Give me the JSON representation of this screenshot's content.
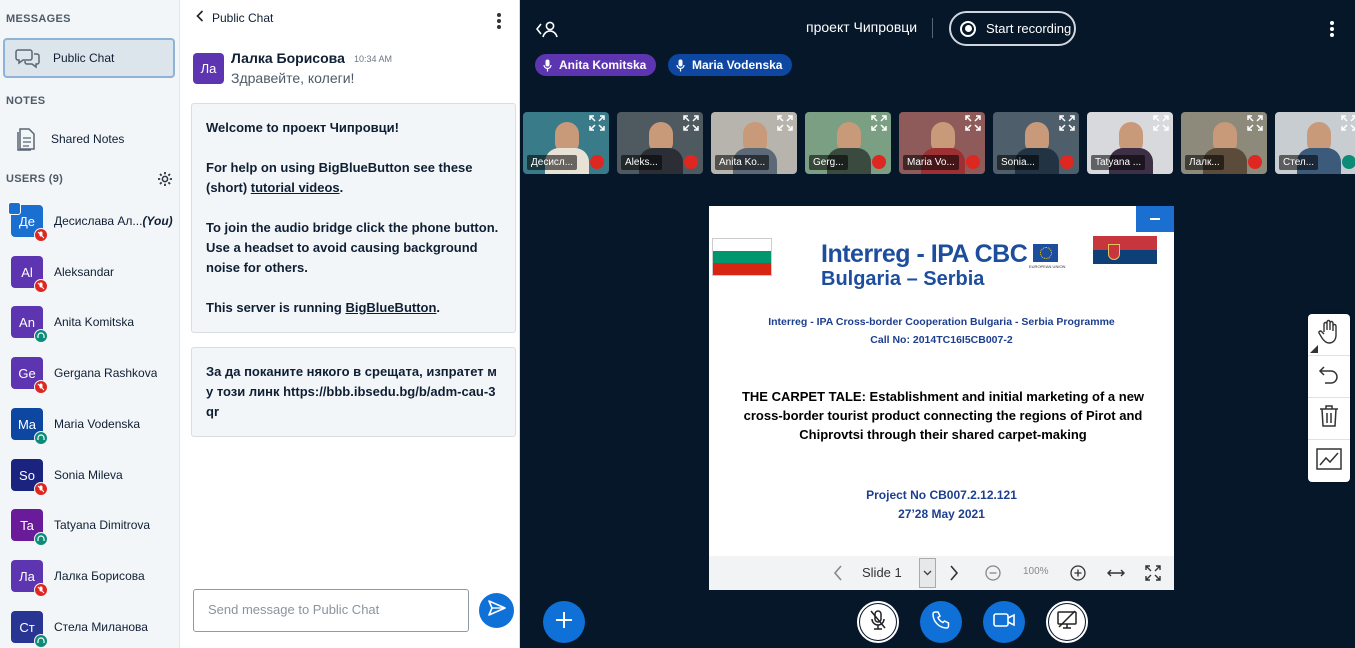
{
  "sidebar": {
    "messages_title": "MESSAGES",
    "public_chat_label": "Public Chat",
    "notes_title": "NOTES",
    "shared_notes_label": "Shared Notes",
    "users_title": "USERS (9)",
    "users": [
      {
        "initials": "Де",
        "name": "Десислава Ал...",
        "you": "(You)",
        "color": "#1b6fd1",
        "status": "muted",
        "presenter": true
      },
      {
        "initials": "Al",
        "name": "Aleksandar",
        "color": "#5e35b1",
        "status": "muted"
      },
      {
        "initials": "An",
        "name": "Anita Komitska",
        "color": "#5e35b1",
        "status": "listen"
      },
      {
        "initials": "Ge",
        "name": "Gergana Rashkova",
        "color": "#5e35b1",
        "status": "muted"
      },
      {
        "initials": "Ma",
        "name": "Maria Vodenska",
        "color": "#0d47a1",
        "status": "listen"
      },
      {
        "initials": "So",
        "name": "Sonia Mileva",
        "color": "#1a237e",
        "status": "muted"
      },
      {
        "initials": "Ta",
        "name": "Tatyana Dimitrova",
        "color": "#6a1b9a",
        "status": "listen"
      },
      {
        "initials": "Ла",
        "name": "Лалка Борисова",
        "color": "#5e35b1",
        "status": "muted"
      },
      {
        "initials": "Ст",
        "name": "Стела Миланова",
        "color": "#283593",
        "status": "listen"
      }
    ]
  },
  "chat": {
    "header": "Public Chat",
    "message": {
      "avatar": "Ла",
      "sender": "Лалка Борисова",
      "time": "10:34 AM",
      "text": "Здравейте, колеги!"
    },
    "welcome": {
      "line1_pre": "Welcome to ",
      "line1_room": "проект Чипровци",
      "line1_post": "!",
      "help_pre": "For help on using BigBlueButton see these (short) ",
      "help_link": "tutorial videos",
      "help_post": ".",
      "audio": "To join the audio bridge click the phone button. Use a headset to avoid causing background noise for others.",
      "server_pre": "This server is running ",
      "server_link": "BigBlueButton",
      "server_post": "."
    },
    "invite": "За да поканите някого в срещата, изпратет му този линк https://bbb.ibsedu.bg/b/adm-cau-3qr",
    "input_placeholder": "Send message to Public Chat"
  },
  "main": {
    "meeting_title": "проект Чипровци",
    "record_label": "Start recording",
    "talkers": [
      {
        "name": "Anita Komitska",
        "color": "#5e35b1"
      },
      {
        "name": "Maria Vodenska",
        "color": "#0d47a1"
      }
    ],
    "videos": [
      {
        "name": "Десисл...",
        "bg": "#3a7b8a",
        "shirt": "#e7e1d6",
        "status": "muted"
      },
      {
        "name": "Aleks...",
        "bg": "#4f5a60",
        "shirt": "#2b2f35",
        "status": "muted"
      },
      {
        "name": "Anita Ko...",
        "bg": "#b7b3ad",
        "shirt": "#5c6a78",
        "status": "none"
      },
      {
        "name": "Gerg...",
        "bg": "#7b9f82",
        "shirt": "#3b4a3f",
        "status": "muted"
      },
      {
        "name": "Maria Vo...",
        "bg": "#8e5a5a",
        "shirt": "#9c3033",
        "status": "muted"
      },
      {
        "name": "Sonia...",
        "bg": "#4e5f6b",
        "shirt": "#223344",
        "status": "muted"
      },
      {
        "name": "Tatyana ...",
        "bg": "#d7d9dc",
        "shirt": "#3d2f45",
        "status": "none"
      },
      {
        "name": "Лалк...",
        "bg": "#8d8a7b",
        "shirt": "#5a4b3a",
        "status": "muted"
      },
      {
        "name": "Стел...",
        "bg": "#c8cdd1",
        "shirt": "#3c5a7a",
        "status": "listen"
      }
    ],
    "slide": {
      "logo_line1": "Interreg - IPA CBC",
      "logo_line2": "Bulgaria – Serbia",
      "programme": "Interreg - IPA Cross-border Cooperation Bulgaria - Serbia Programme",
      "call": "Call No: 2014TC16I5CB007-2",
      "title": "THE CARPET TALE: Establishment and initial marketing of a new cross-border tourist product connecting the regions of Pirot and Chiprovtsi through their shared carpet-making",
      "project": "Project No CB007.2.12.121",
      "date": "27’28 May 2021",
      "eu_small": "EUROPEAN UNION"
    },
    "slide_label": "Slide 1",
    "zoom": "100%"
  }
}
